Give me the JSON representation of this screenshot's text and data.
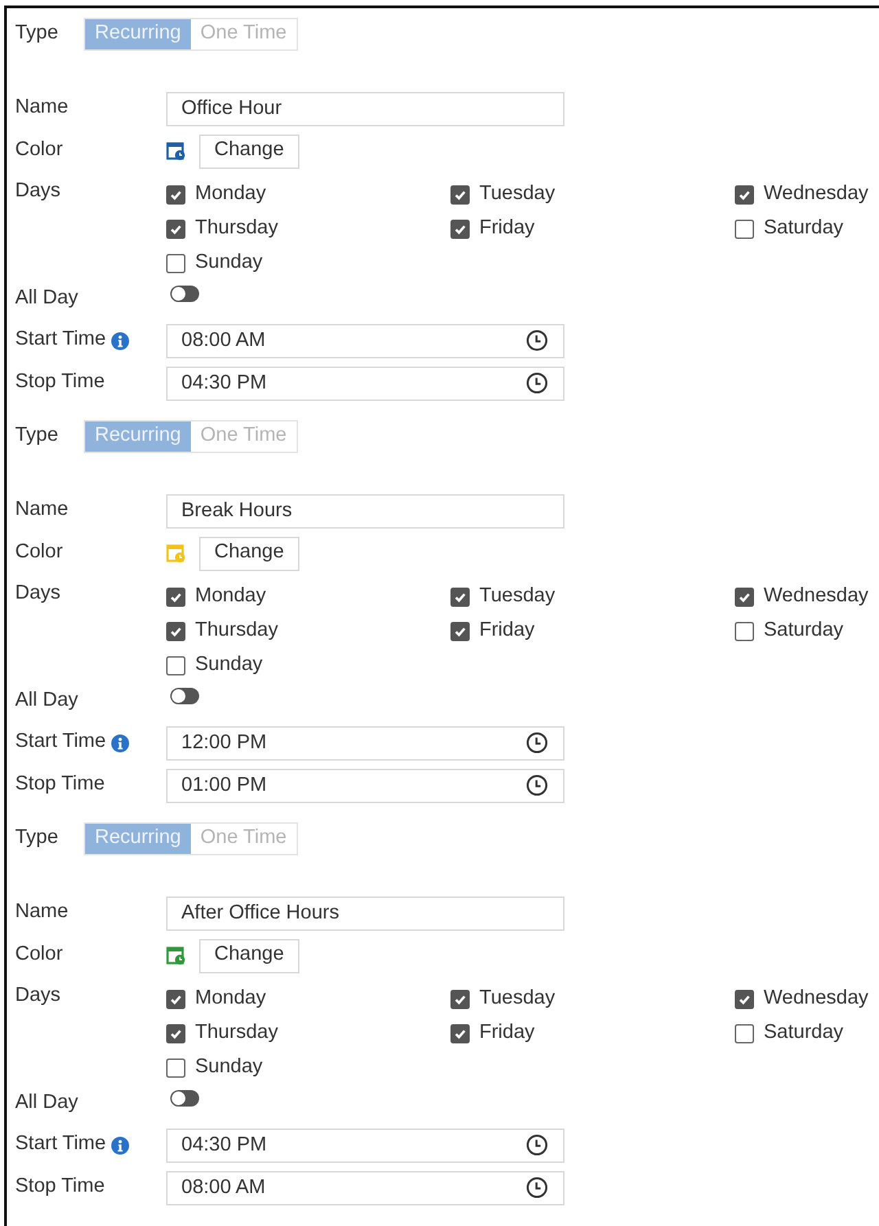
{
  "schedules": [
    {
      "type_label": "Type",
      "type_options": [
        {
          "label": "Recurring",
          "selected": true
        },
        {
          "label": "One Time",
          "selected": false
        }
      ],
      "name_label": "Name",
      "name": "Office Hour",
      "color_label": "Color",
      "color": "#1f5fa8",
      "change_button": "Change",
      "days_label": "Days",
      "days": [
        {
          "label": "Monday",
          "checked": true
        },
        {
          "label": "Tuesday",
          "checked": true
        },
        {
          "label": "Wednesday",
          "checked": true
        },
        {
          "label": "Thursday",
          "checked": true
        },
        {
          "label": "Friday",
          "checked": true
        },
        {
          "label": "Saturday",
          "checked": false
        },
        {
          "label": "Sunday",
          "checked": false
        }
      ],
      "all_day_label": "All Day",
      "all_day": false,
      "start_label": "Start Time",
      "start": "08:00 AM",
      "stop_label": "Stop Time",
      "stop": "04:30 PM"
    },
    {
      "type_label": "Type",
      "type_options": [
        {
          "label": "Recurring",
          "selected": true
        },
        {
          "label": "One Time",
          "selected": false
        }
      ],
      "name_label": "Name",
      "name": "Break Hours",
      "color_label": "Color",
      "color": "#f2c31a",
      "change_button": "Change",
      "days_label": "Days",
      "days": [
        {
          "label": "Monday",
          "checked": true
        },
        {
          "label": "Tuesday",
          "checked": true
        },
        {
          "label": "Wednesday",
          "checked": true
        },
        {
          "label": "Thursday",
          "checked": true
        },
        {
          "label": "Friday",
          "checked": true
        },
        {
          "label": "Saturday",
          "checked": false
        },
        {
          "label": "Sunday",
          "checked": false
        }
      ],
      "all_day_label": "All Day",
      "all_day": false,
      "start_label": "Start Time",
      "start": "12:00 PM",
      "stop_label": "Stop Time",
      "stop": "01:00 PM"
    },
    {
      "type_label": "Type",
      "type_options": [
        {
          "label": "Recurring",
          "selected": true
        },
        {
          "label": "One Time",
          "selected": false
        }
      ],
      "name_label": "Name",
      "name": "After Office Hours",
      "color_label": "Color",
      "color": "#2e9a3c",
      "change_button": "Change",
      "days_label": "Days",
      "days": [
        {
          "label": "Monday",
          "checked": true
        },
        {
          "label": "Tuesday",
          "checked": true
        },
        {
          "label": "Wednesday",
          "checked": true
        },
        {
          "label": "Thursday",
          "checked": true
        },
        {
          "label": "Friday",
          "checked": true
        },
        {
          "label": "Saturday",
          "checked": false
        },
        {
          "label": "Sunday",
          "checked": false
        }
      ],
      "all_day_label": "All Day",
      "all_day": false,
      "start_label": "Start Time",
      "start": "04:30 PM",
      "stop_label": "Stop Time",
      "stop": "08:00 AM"
    }
  ]
}
